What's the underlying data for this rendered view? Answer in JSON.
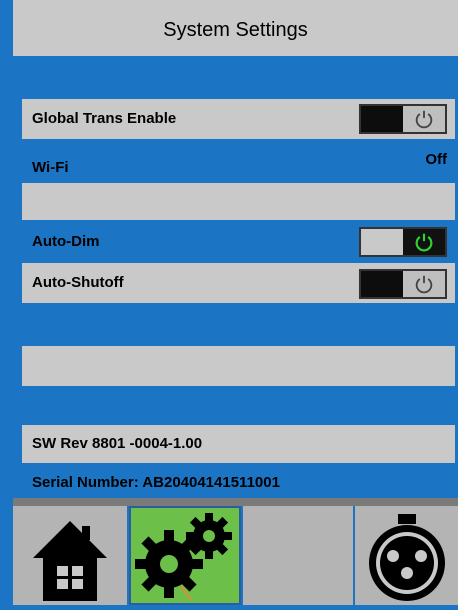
{
  "header": {
    "title": "System Settings"
  },
  "settings": {
    "global_trans_enable": {
      "label": "Global Trans Enable",
      "state": "off"
    },
    "wifi": {
      "label": "Wi-Fi",
      "value": "Off"
    },
    "auto_dim": {
      "label": "Auto-Dim",
      "state": "on"
    },
    "auto_shutoff": {
      "label": "Auto-Shutoff",
      "state": "off"
    }
  },
  "info": {
    "sw_rev": "SW  Rev 8801 -0004-1.00",
    "serial": "Serial Number:  AB20404141511001"
  },
  "nav": {
    "items": [
      "home-icon",
      "settings-gears-icon",
      "blank",
      "xlr-connector-icon"
    ],
    "active": "settings-gears-icon"
  },
  "colors": {
    "panel_blue": "#1c74c4",
    "row_gray": "#c9c9c9",
    "active_green": "#6cc04a",
    "power_on_green": "#2fd02f"
  }
}
